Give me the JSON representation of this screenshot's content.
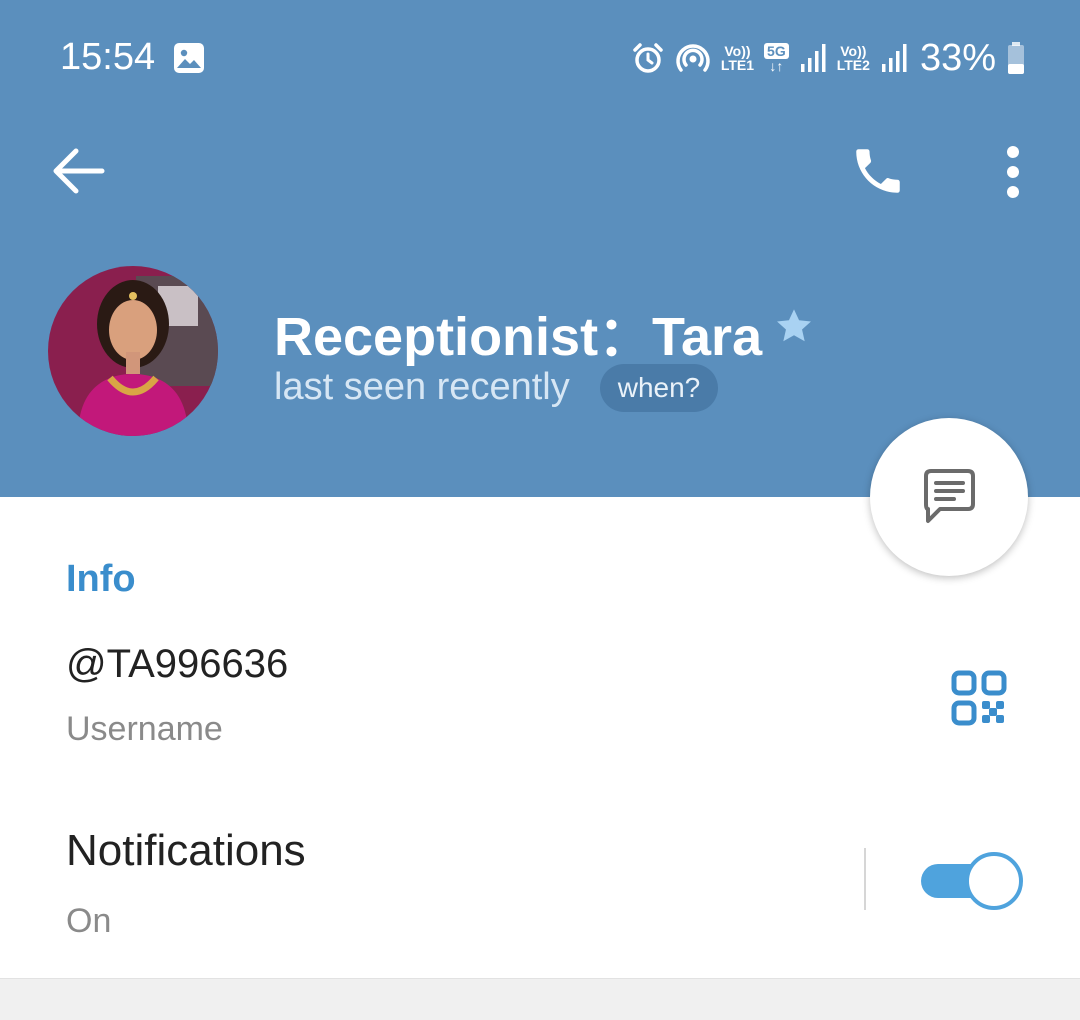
{
  "status_bar": {
    "time": "15:54",
    "gallery_icon": "image-icon",
    "icons": [
      "alarm-icon",
      "hotspot-icon",
      "volte-lte1-icon",
      "5g-icon",
      "signal-icon",
      "volte-lte2-icon",
      "signal-icon",
      "battery-icon"
    ],
    "volte_label": "Vo))",
    "lte1_label": "LTE1",
    "lte2_label": "LTE2",
    "network_label": "5G",
    "battery_percent": "33%"
  },
  "toolbar": {
    "back_icon": "arrow-left-icon",
    "call_icon": "phone-icon",
    "more_icon": "more-vertical-icon"
  },
  "profile": {
    "name": "Receptionist：Tara",
    "premium_icon": "star-icon",
    "last_seen": "last seen recently",
    "when_chip": "when?"
  },
  "fab": {
    "icon": "message-icon"
  },
  "info": {
    "section_title": "Info",
    "username": "@TA996636",
    "username_label": "Username",
    "qr_icon": "qr-code-icon",
    "notifications_label": "Notifications",
    "notifications_status": "On",
    "notifications_enabled": true
  },
  "colors": {
    "header": "#5b8fbd",
    "accent": "#3a8dcc",
    "toggle": "#4fa3dd"
  }
}
